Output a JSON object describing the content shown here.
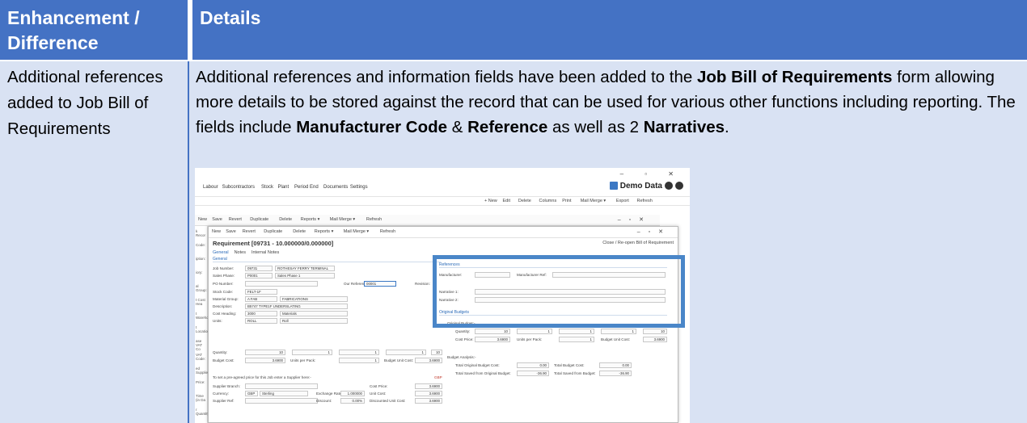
{
  "table": {
    "headers": [
      "Enhancement / Difference",
      "Details"
    ],
    "row": {
      "enhancement": "Additional references added to Job Bill of Requirements",
      "details_parts": [
        {
          "t": "Additional references and information fields have been added to the ",
          "b": false
        },
        {
          "t": "Job Bill of Requirements",
          "b": true
        },
        {
          "t": " form allowing more details to be stored against the record that can be used for various other functions including reporting.  The fields include ",
          "b": false
        },
        {
          "t": "Manufacturer Code",
          "b": true
        },
        {
          "t": " & ",
          "b": false
        },
        {
          "t": "Reference",
          "b": true
        },
        {
          "t": " as well as 2 ",
          "b": false
        },
        {
          "t": "Narratives",
          "b": true
        },
        {
          "t": ".",
          "b": false
        }
      ]
    }
  },
  "colors": {
    "header_bg": "#4472c4",
    "row_bg": "#d9e2f3",
    "highlight": "#4a86c8"
  },
  "screenshot": {
    "menu": [
      "Labour",
      "Subcontractors",
      "Stock",
      "Plant",
      "Period End",
      "Documents",
      "Settings"
    ],
    "company": "Demo Data",
    "toolbar1": [
      "+ New",
      "Edit",
      "Delete",
      "Columns",
      "Print",
      "Mail Merge ▾",
      "Export",
      "Refresh"
    ],
    "inner_toolbar": [
      "New",
      "Save",
      "Revert",
      "Duplicate",
      "Delete",
      "Reports ▾",
      "Mail Merge ▾",
      "Refresh"
    ],
    "left_labels": [
      "k Recor",
      "Code:",
      "iption:",
      "iory:",
      "al Group:",
      "t Cost Hea",
      "t Warehou",
      "t Location:",
      "ase VAT Co",
      "VAT Code:",
      "ed Supplie",
      "Price:",
      "Time (in Da",
      "r Quantity"
    ],
    "title": "Requirement [09731 - 10.000000/0.000000]",
    "close_label": "Close / Re-open Bill of Requirement",
    "tabs": [
      "General",
      "Notes",
      "Internal Notes"
    ],
    "general": {
      "section": "General",
      "job_number_label": "Job Number:",
      "job_number": "09731",
      "job_name": "ROTHESAY FERRY TERMINAL",
      "sales_phase_label": "Sales Phase:",
      "sales_phase": "P0001",
      "sales_phase_name": "Sales Phase 1",
      "po_label": "PO Number:",
      "our_ref_label": "Our Reference:",
      "our_ref": "00001",
      "revision_label": "Revision:",
      "stock_code_label": "Stock Code:",
      "stock_code": "FELT-1F",
      "material_group_label": "Material Group:",
      "material_group": "A FAB",
      "material_group_name": "FABRICATIONS",
      "description_label": "Description:",
      "description": "B5747 TYPE1F UNDERSLATING",
      "cost_heading_label": "Cost Heading:",
      "cost_heading": "3000",
      "cost_heading_name": "Materials",
      "units_label": "Units:",
      "units": "ROLL",
      "units_name": "Roll",
      "quantity_label": "Quantity:",
      "quantity": "10",
      "q1": "1",
      "q2": "1",
      "q3": "1",
      "qtotal": "10",
      "budget_cost_label": "Budget Cost:",
      "budget_cost": "3.6900",
      "units_per_pack_label": "Units per Pack:",
      "units_per_pack": "1",
      "budget_unit_cost_label": "Budget Unit Cost:",
      "budget_unit_cost": "3.6900",
      "supplier_note": "To set a pre-agreed price for this Job enter a Supplier here:-",
      "gbp": "GBP",
      "supplier_branch_label": "Supplier Branch:",
      "cost_price_label": "Cost Price:",
      "cost_price": "3.6900",
      "currency_label": "Currency:",
      "currency": "GBP",
      "currency_name": "Sterling",
      "exchange_label": "Exchange Rate:",
      "exchange": "1.000000",
      "unit_cost_label": "Unit Cost:",
      "unit_cost": "3.6900",
      "supplier_ref_label": "Supplier Ref:",
      "discount_label": "Discount:",
      "discount": "0.00%",
      "disc_unit_cost_label": "Discounted Unit Cost:",
      "disc_unit_cost": "3.6900"
    },
    "references": {
      "section": "References",
      "manufacturer_label": "Manufacturer:",
      "manufacturer_ref_label": "Manufacturer Ref:",
      "narrative1_label": "Narrative 1:",
      "narrative2_label": "Narrative 2:"
    },
    "budgets": {
      "section": "Original Budgets",
      "orig_label": "Original Budget:-",
      "quantity_label": "Quantity:",
      "quantity": "10",
      "q1": "1",
      "q2": "1",
      "q3": "1",
      "qtotal": "10",
      "cost_price_label": "Cost Price:",
      "cost_price": "3.6900",
      "units_per_pack_label": "Units per Pack:",
      "units_per_pack": "1",
      "budget_unit_cost_label": "Budget Unit Cost:",
      "budget_unit_cost": "3.6900",
      "analysis_label": "Budget Analysis:-",
      "total_orig_label": "Total Original Budget Cost:",
      "total_orig": "0.00",
      "total_budget_label": "Total Budget Cost:",
      "total_budget": "0.00",
      "saved_orig_label": "Total Saved from Original Budget:",
      "saved_orig": "-36.90",
      "saved_budget_label": "Total Saved from Budget:",
      "saved_budget": "-36.90"
    }
  }
}
